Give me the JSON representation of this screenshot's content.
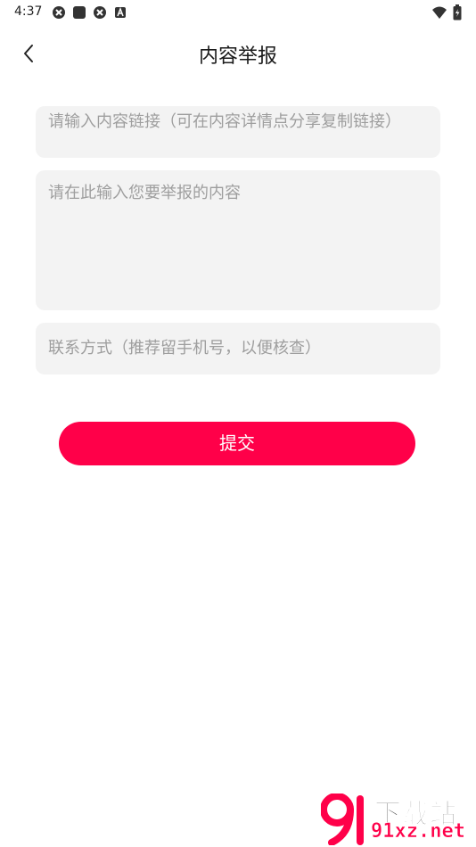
{
  "status_bar": {
    "time": "4:37",
    "left_icons": [
      "notification-icon",
      "app-icon",
      "notification-icon",
      "a-icon"
    ],
    "right_icons": [
      "wifi-icon",
      "battery-icon"
    ]
  },
  "header": {
    "title": "内容举报",
    "back_icon": "chevron-left-icon"
  },
  "form": {
    "link_placeholder": "请输入内容链接（可在内容详情点分享复制链接）",
    "content_placeholder": "请在此输入您要举报的内容",
    "contact_placeholder": "联系方式（推荐留手机号，以便核查）",
    "submit_label": "提交"
  },
  "watermark": {
    "top_text": "下载站",
    "bottom_text": "91xz.net"
  },
  "colors": {
    "accent": "#ff0049",
    "field_bg": "#f3f3f3",
    "placeholder": "#9e9e9e"
  }
}
